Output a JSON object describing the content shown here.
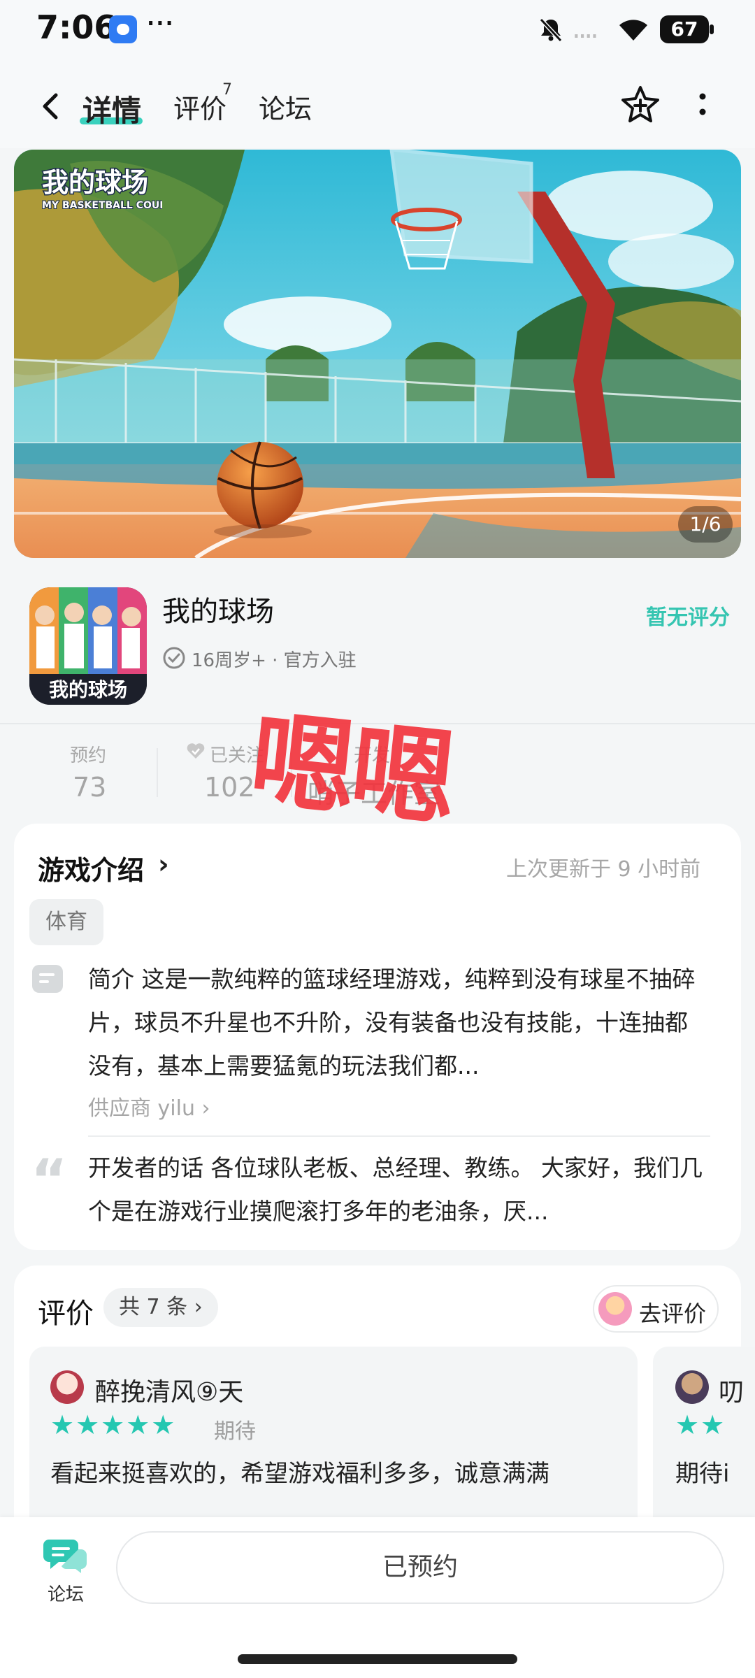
{
  "status_bar": {
    "time": "7:06",
    "more": "···",
    "signal": "....",
    "battery": "67"
  },
  "header": {
    "tabs": [
      {
        "label": "详情",
        "active": true
      },
      {
        "label": "评价",
        "badge": "7"
      },
      {
        "label": "论坛"
      }
    ],
    "icons": [
      "back-icon",
      "favorite-star-icon",
      "more-icon"
    ]
  },
  "banner": {
    "logo_text": "我的球场",
    "logo_subtext": "MY BASKETBALL COURT",
    "counter": "1/6"
  },
  "app": {
    "name": "我的球场",
    "meta": "16周岁+ · 官方入驻",
    "rating": "暂无评分",
    "icon_caption": "我的球场"
  },
  "stats": [
    {
      "label": "预约",
      "value": "73"
    },
    {
      "label": "已关注",
      "value": "102"
    },
    {
      "label": "开发",
      "value": "哨子工作室"
    }
  ],
  "stamp": "嗯嗯",
  "intro": {
    "title": "游戏介绍",
    "arrow": "›",
    "updated": "上次更新于 9 小时前",
    "tag": "体育",
    "summary": "简介 这是一款纯粹的篮球经理游戏，纯粹到没有球星不抽碎片，球员不升星也不升阶，没有装备也没有技能，十连抽都没有，基本上需要猛氪的玩法我们都...",
    "supplier": "供应商 yilu ›",
    "developer_note": "开发者的话 各位球队老板、总经理、教练。 大家好，我们几个是在游戏行业摸爬滚打多年的老油条，厌..."
  },
  "reviews": {
    "title": "评价",
    "count": "共 7 条 ›",
    "go_review": "去评价",
    "items": [
      {
        "name": "醉挽清风⑨天",
        "stars": "★★★★★",
        "tag": "期待",
        "text": "看起来挺喜欢的，希望游戏福利多多，诚意满满"
      },
      {
        "name": "叨",
        "stars": "★★",
        "text": "期待i"
      }
    ]
  },
  "bottom": {
    "forum_label": "论坛",
    "reserve_label": "已预约"
  },
  "colors": {
    "accent": "#35c5b1",
    "stamp": "#f2353e",
    "background": "#f4f6f7"
  }
}
